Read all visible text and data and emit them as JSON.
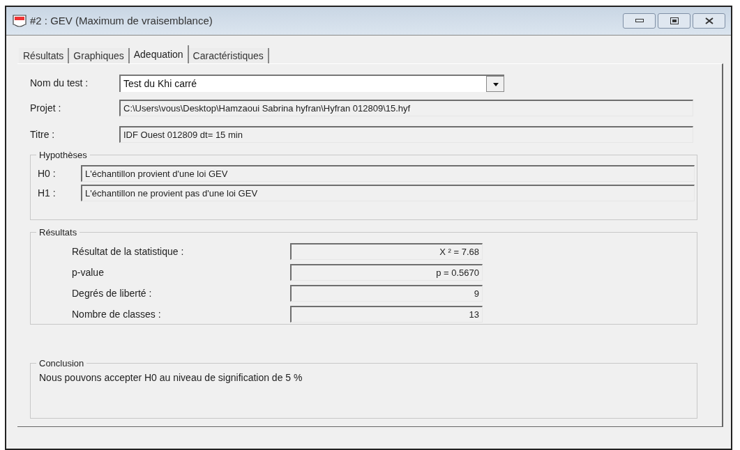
{
  "window": {
    "title": "#2 : GEV (Maximum de vraisemblance)"
  },
  "tabs": [
    {
      "label": "Résultats",
      "selected": false
    },
    {
      "label": "Graphiques",
      "selected": false
    },
    {
      "label": "Adequation",
      "selected": true
    },
    {
      "label": "Caractéristiques",
      "selected": false
    }
  ],
  "test": {
    "label": "Nom du test :",
    "value": "Test du Khi carré"
  },
  "projet": {
    "label": "Projet :",
    "value": "C:\\Users\\vous\\Desktop\\Hamzaoui Sabrina hyfran\\Hyfran 012809\\15.hyf"
  },
  "titre": {
    "label": "Titre :",
    "value": "IDF  Ouest 012809 dt= 15 min"
  },
  "hypotheses": {
    "title": "Hypothèses",
    "items": [
      {
        "label": "H0 :",
        "value": "L'échantillon provient d'une loi GEV"
      },
      {
        "label": "H1 :",
        "value": "L'échantillon ne provient pas d'une loi GEV"
      }
    ]
  },
  "resultats": {
    "title": "Résultats",
    "rows": [
      {
        "label": "Résultat de la statistique :",
        "value": "X ² = 7.68"
      },
      {
        "label": "p-value",
        "value": "p = 0.5670"
      },
      {
        "label": "Degrés de liberté :",
        "value": "9"
      },
      {
        "label": "Nombre de classes :",
        "value": "13"
      }
    ]
  },
  "conclusion": {
    "title": "Conclusion",
    "text": "Nous pouvons accepter H0 au niveau de signification de 5 %"
  }
}
